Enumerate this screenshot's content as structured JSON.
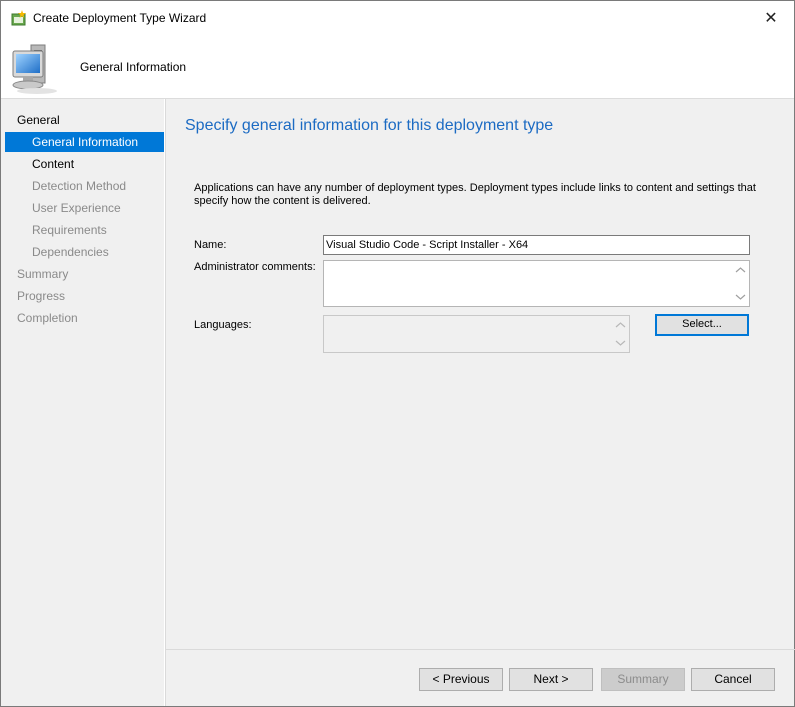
{
  "window": {
    "title": "Create Deployment Type Wizard",
    "title_icon": "wizard-icon",
    "close_glyph": "✕"
  },
  "header": {
    "title": "General Information",
    "icon": "computer-icon"
  },
  "nav": {
    "items": [
      {
        "label": "General",
        "level": 0,
        "state": "enabled"
      },
      {
        "label": "General Information",
        "level": 1,
        "state": "selected"
      },
      {
        "label": "Content",
        "level": 1,
        "state": "enabled"
      },
      {
        "label": "Detection Method",
        "level": 1,
        "state": "disabled"
      },
      {
        "label": "User Experience",
        "level": 1,
        "state": "disabled"
      },
      {
        "label": "Requirements",
        "level": 1,
        "state": "disabled"
      },
      {
        "label": "Dependencies",
        "level": 1,
        "state": "disabled"
      },
      {
        "label": "Summary",
        "level": 0,
        "state": "disabled"
      },
      {
        "label": "Progress",
        "level": 0,
        "state": "disabled"
      },
      {
        "label": "Completion",
        "level": 0,
        "state": "disabled"
      }
    ]
  },
  "main": {
    "heading": "Specify general information for this deployment type",
    "description": "Applications can have any number of deployment types. Deployment types include links to content and settings that specify how the content is delivered.",
    "name_label": "Name:",
    "name_value": "Visual Studio Code - Script Installer - X64",
    "comments_label": "Administrator comments:",
    "comments_value": "",
    "languages_label": "Languages:",
    "languages_value": "",
    "select_button": "Select..."
  },
  "footer": {
    "previous": "< Previous",
    "next": "Next >",
    "summary": "Summary",
    "cancel": "Cancel"
  },
  "colors": {
    "accent": "#0078d7",
    "heading": "#1c6bc3",
    "panel_bg": "#f0f0f0"
  }
}
